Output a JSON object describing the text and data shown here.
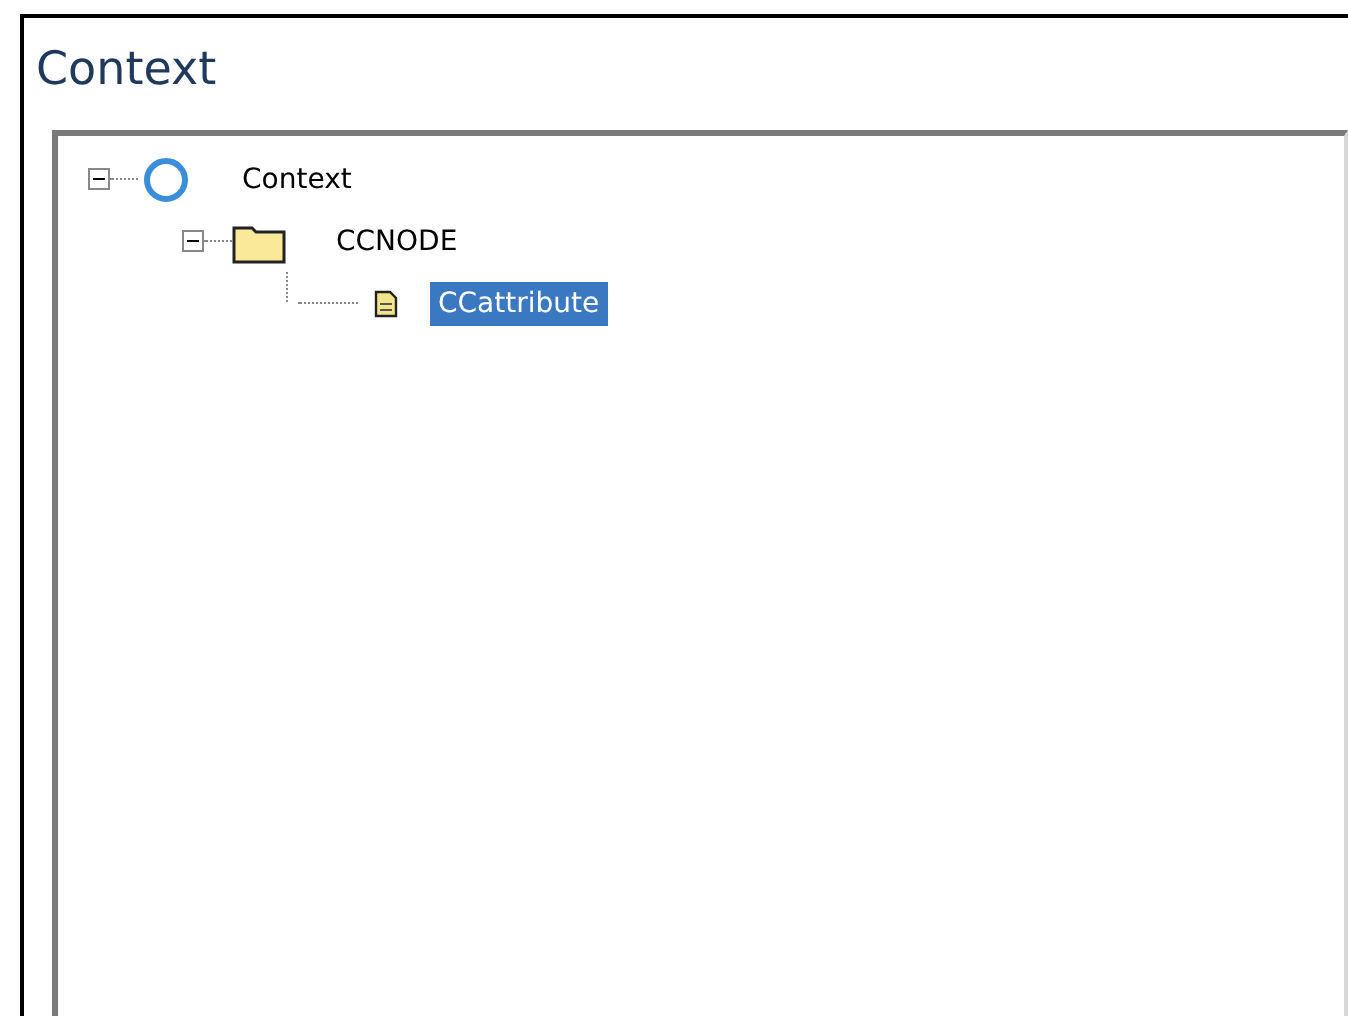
{
  "title": "Context",
  "tree": [
    {
      "kind": "context",
      "label": "Context",
      "expanded": true,
      "selected": false,
      "children": [
        {
          "kind": "node",
          "label": "CCNODE",
          "expanded": true,
          "selected": false,
          "children": [
            {
              "kind": "attribute",
              "label": "CCattribute",
              "selected": true
            }
          ]
        }
      ]
    }
  ]
}
